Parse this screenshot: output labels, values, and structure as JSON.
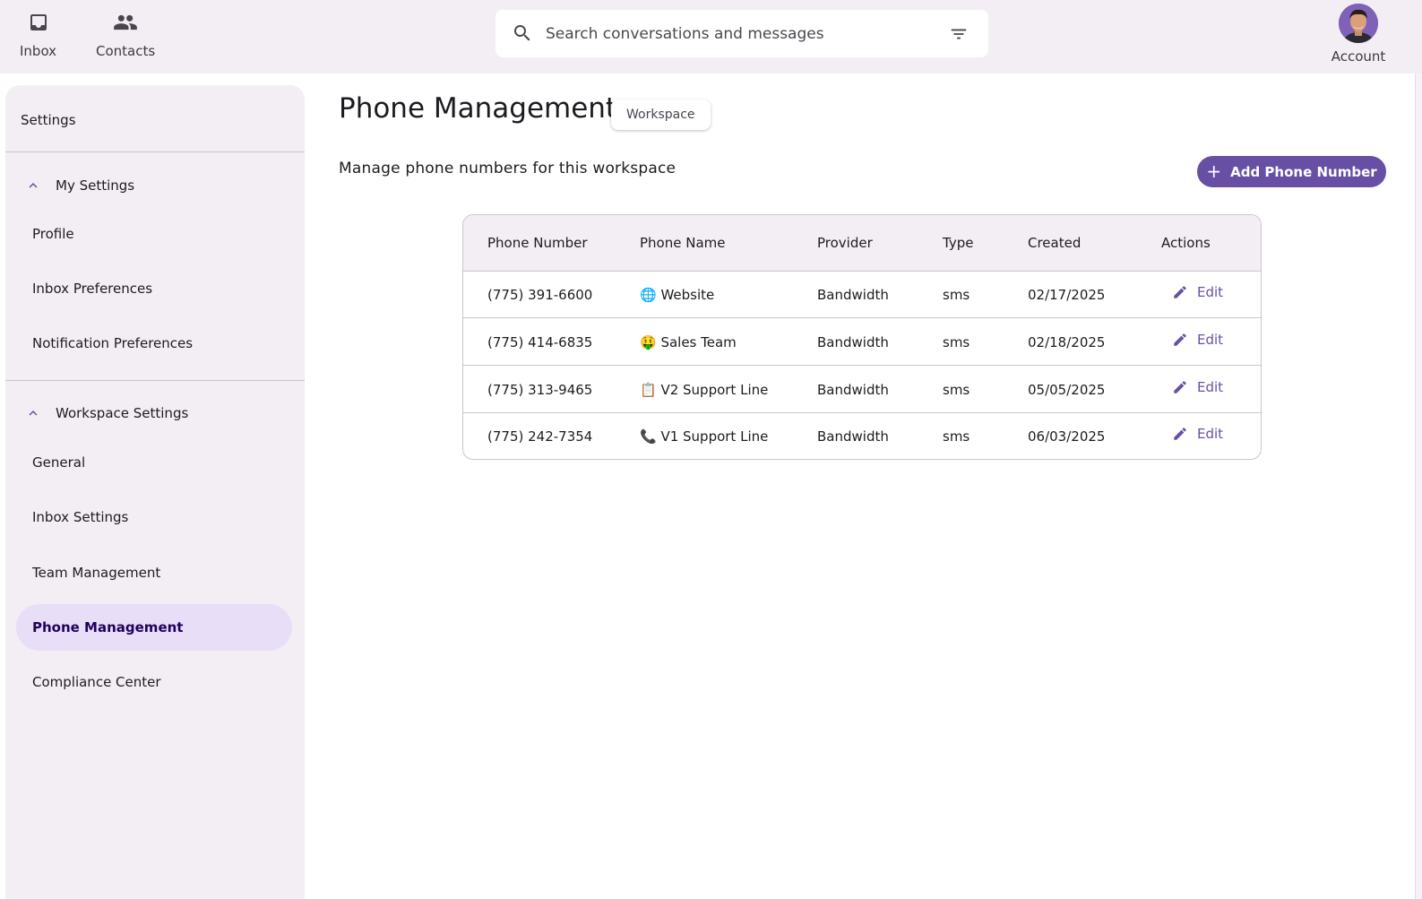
{
  "nav": {
    "inbox_label": "Inbox",
    "contacts_label": "Contacts",
    "account_label": "Account"
  },
  "search": {
    "placeholder": "Search conversations and messages"
  },
  "sidebar": {
    "title": "Settings",
    "my_settings": {
      "label": "My Settings",
      "items": [
        "Profile",
        "Inbox Preferences",
        "Notification Preferences"
      ]
    },
    "workspace_settings": {
      "label": "Workspace Settings",
      "items": [
        "General",
        "Inbox Settings",
        "Team Management",
        "Phone Management",
        "Compliance Center"
      ]
    },
    "active_item": "Phone Management"
  },
  "main": {
    "title": "Phone Management",
    "chip": "Workspace",
    "subtitle": "Manage phone numbers for this workspace",
    "add_button": "Add Phone Number"
  },
  "table": {
    "headers": [
      "Phone Number",
      "Phone Name",
      "Provider",
      "Type",
      "Created",
      "Actions"
    ],
    "rows": [
      {
        "number": "(775) 391-6600",
        "name": "🌐 Website",
        "provider": "Bandwidth",
        "type": "sms",
        "created": "02/17/2025",
        "action": "Edit"
      },
      {
        "number": "(775) 414-6835",
        "name": "🤑 Sales Team",
        "provider": "Bandwidth",
        "type": "sms",
        "created": "02/18/2025",
        "action": "Edit"
      },
      {
        "number": "(775) 313-9465",
        "name": "📋 V2 Support Line",
        "provider": "Bandwidth",
        "type": "sms",
        "created": "05/05/2025",
        "action": "Edit"
      },
      {
        "number": "(775) 242-7354",
        "name": "📞 V1 Support Line",
        "provider": "Bandwidth",
        "type": "sms",
        "created": "06/03/2025",
        "action": "Edit"
      }
    ]
  },
  "colors": {
    "primary": "#6750a4",
    "surface": "#f3eef4",
    "active_nav": "#e8def8",
    "outline": "#cac4d0"
  }
}
